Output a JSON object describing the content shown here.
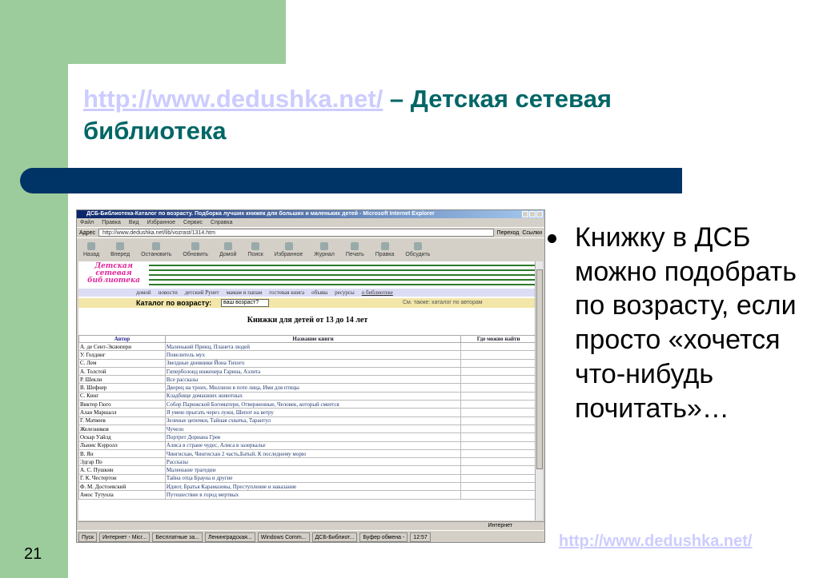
{
  "slide": {
    "title_link": "http://www.dedushka.net/",
    "title_rest": " – Детская сетевая библиотека",
    "bullet": "Книжку в ДСБ можно подобрать по возрасту, если просто «хочется что-нибудь почитать»…",
    "footer_link": "http://www.dedushka.net/",
    "slide_number": "21",
    "colors": {
      "green": "#9ccc9c",
      "bar": "#003366",
      "title": "#006666",
      "link": "#ccccff"
    }
  },
  "browser": {
    "title": "ДСБ-Библиотека-Каталог по возрасту. Подборка лучших книжек для больших и маленьких детей - Microsoft Internet Explorer",
    "menu": [
      "Файл",
      "Правка",
      "Вид",
      "Избранное",
      "Сервис",
      "Справка"
    ],
    "address_label": "Адрес",
    "address": "http://www.dedushka.net/lib/vozrast/1314.htm",
    "go": "Переход",
    "links": "Ссылки",
    "toolbar": [
      "Назад",
      "Вперед",
      "Остановить",
      "Обновить",
      "Домой",
      "Поиск",
      "Избранное",
      "Журнал",
      "Печать",
      "Правка",
      "Обсудить"
    ],
    "status": "Интернет",
    "taskbar": [
      "Пуск",
      "Интернет - Micr...",
      "Бесплатные за...",
      "Ленинградская...",
      "Windows Comm...",
      "ДСБ-Библиот...",
      "Буфер обмена -",
      "12:57"
    ]
  },
  "site": {
    "logo": "Детская сетевая библиотека",
    "nav": [
      "домой",
      "новости",
      "детский Рунет",
      "мамам и папам",
      "гостевая книга",
      "объява",
      "ресурсы",
      "о библиотеке"
    ],
    "catalog_label": "Каталог по возрасту:",
    "catalog_select": "ваш возраст?",
    "see_also": "См. также: каталог по авторам",
    "heading": "Книжки для детей от 13 до 14 лет",
    "columns": [
      "Автор",
      "Название книги",
      "Где можно найти"
    ],
    "rows": [
      [
        "А. де Сент-Экзюпери",
        "Маленький Принц, Планета людей"
      ],
      [
        "У. Голдинг",
        "Повелитель мух"
      ],
      [
        "С. Лем",
        "Звездные дневники Йона Тихого"
      ],
      [
        "А. Толстой",
        "Гиперболоид инженера Гарина, Аэлита"
      ],
      [
        "Р. Шекли",
        "Все рассказы"
      ],
      [
        "В. Шефнер",
        "Дворец на троих, Миллион в поте лица, Имя для птицы"
      ],
      [
        "С. Кинг",
        "Кладбище домашних животных"
      ],
      [
        "Виктор Гюго",
        "Собор Парижской Богоматери, Отверженные, Человек, который смеется"
      ],
      [
        "Алан Маршалл",
        "Я умею прыгать через лужи, Шепот на ветру"
      ],
      [
        "Г. Матвеев",
        "Зеленые цепочки, Тайная схватка, Тарантул"
      ],
      [
        "Железников",
        "Чучело"
      ],
      [
        "Оскар Уайлд",
        "Портрет Дориана Грея"
      ],
      [
        "Льюис Кэрролл",
        "Алиса в стране чудес, Алиса в зазеркалье"
      ],
      [
        "В. Ян",
        "Чингисхан, Чингисхан 2 часть,Батый, К последнему морю"
      ],
      [
        "Эдгар По",
        "Рассказы"
      ],
      [
        "А. С. Пушкин",
        "Маленькие трагедии"
      ],
      [
        "Г. К. Честертон",
        "Тайна отца Брауна и другие"
      ],
      [
        "Ф. М. Достоевский",
        "Идиот, Братья Карамазовы, Преступление и наказание"
      ],
      [
        "Амос Тутуола",
        "Путешествие в город мертвых"
      ]
    ]
  }
}
